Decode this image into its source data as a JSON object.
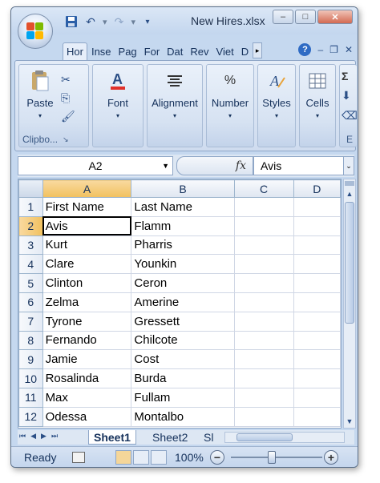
{
  "window": {
    "title": "New Hires.xlsx",
    "ctrl_minimize": "–",
    "ctrl_maximize": "□",
    "ctrl_close": "✕"
  },
  "qat": {
    "save_icon": "save-icon",
    "undo_icon": "undo-icon",
    "redo_icon": "redo-icon",
    "customize_icon": "customize-icon"
  },
  "ribbon_tabs": [
    "Hor",
    "Inse",
    "Pag",
    "For",
    "Dat",
    "Rev",
    "Viet",
    "D"
  ],
  "ribbon_tab_scroll": "▸",
  "ribbon_groups": [
    {
      "label": "Clipbo...",
      "button": "Paste",
      "icon": "paste-icon"
    },
    {
      "label": "",
      "button": "Font",
      "icon": "font-icon"
    },
    {
      "label": "",
      "button": "Alignment",
      "icon": "alignment-icon"
    },
    {
      "label": "",
      "button": "Number",
      "icon": "number-icon"
    },
    {
      "label": "",
      "button": "Styles",
      "icon": "styles-icon"
    },
    {
      "label": "",
      "button": "Cells",
      "icon": "cells-icon"
    },
    {
      "label": "E",
      "button": "",
      "icon": "editing-icon"
    }
  ],
  "formula_bar": {
    "name_box": "A2",
    "fx": "fx",
    "value": "Avis"
  },
  "grid": {
    "columns": [
      "A",
      "B",
      "C",
      "D"
    ],
    "rows": [
      {
        "num": "1",
        "a": "First Name",
        "b": "Last Name"
      },
      {
        "num": "2",
        "a": "Avis",
        "b": "Flamm"
      },
      {
        "num": "3",
        "a": "Kurt",
        "b": "Pharris"
      },
      {
        "num": "4",
        "a": "Clare",
        "b": "Younkin"
      },
      {
        "num": "5",
        "a": "Clinton",
        "b": "Ceron"
      },
      {
        "num": "6",
        "a": "Zelma",
        "b": "Amerine"
      },
      {
        "num": "7",
        "a": "Tyrone",
        "b": "Gressett"
      },
      {
        "num": "8",
        "a": "Fernando",
        "b": "Chilcote"
      },
      {
        "num": "9",
        "a": "Jamie",
        "b": "Cost"
      },
      {
        "num": "10",
        "a": "Rosalinda",
        "b": "Burda"
      },
      {
        "num": "11",
        "a": "Max",
        "b": "Fullam"
      },
      {
        "num": "12",
        "a": "Odessa",
        "b": "Montalbo"
      }
    ],
    "selected_cell": "A2"
  },
  "sheets": {
    "tabs": [
      "Sheet1",
      "Sheet2",
      "Sl"
    ],
    "active": "Sheet1"
  },
  "status": {
    "text": "Ready",
    "zoom": "100%",
    "zoom_minus": "−",
    "zoom_plus": "+"
  }
}
